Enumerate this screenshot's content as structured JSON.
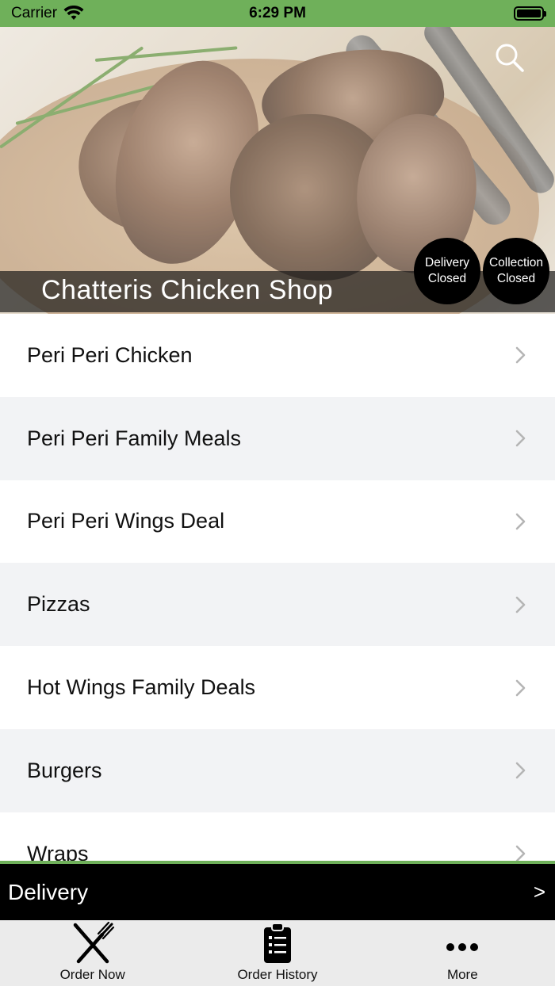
{
  "status_bar": {
    "carrier": "Carrier",
    "time": "6:29 PM",
    "wifi_icon": "wifi-icon",
    "battery_icon": "battery-icon"
  },
  "header": {
    "shop_name": "Chatteris Chicken Shop",
    "search_icon": "search-icon",
    "delivery_status": {
      "line1": "Delivery",
      "line2": "Closed"
    },
    "collection_status": {
      "line1": "Collection",
      "line2": "Closed"
    }
  },
  "menu": {
    "chevron_icon": "chevron-right-icon",
    "items": [
      {
        "label": "Peri Peri Chicken"
      },
      {
        "label": "Peri Peri Family Meals"
      },
      {
        "label": "Peri Peri Wings Deal"
      },
      {
        "label": "Pizzas"
      },
      {
        "label": "Hot Wings Family Deals"
      },
      {
        "label": "Burgers"
      },
      {
        "label": "Wraps"
      }
    ]
  },
  "order_mode": {
    "label": "Delivery",
    "arrow": ">"
  },
  "tab_bar": {
    "tabs": [
      {
        "label": "Order Now",
        "icon": "fork-knife-icon"
      },
      {
        "label": "Order History",
        "icon": "clipboard-list-icon"
      },
      {
        "label": "More",
        "icon": "more-dots-icon"
      }
    ]
  },
  "colors": {
    "accent_green": "#6fb05a",
    "bar_black": "#000000",
    "row_alt": "#f2f3f5",
    "tab_bg": "#ebebeb"
  }
}
